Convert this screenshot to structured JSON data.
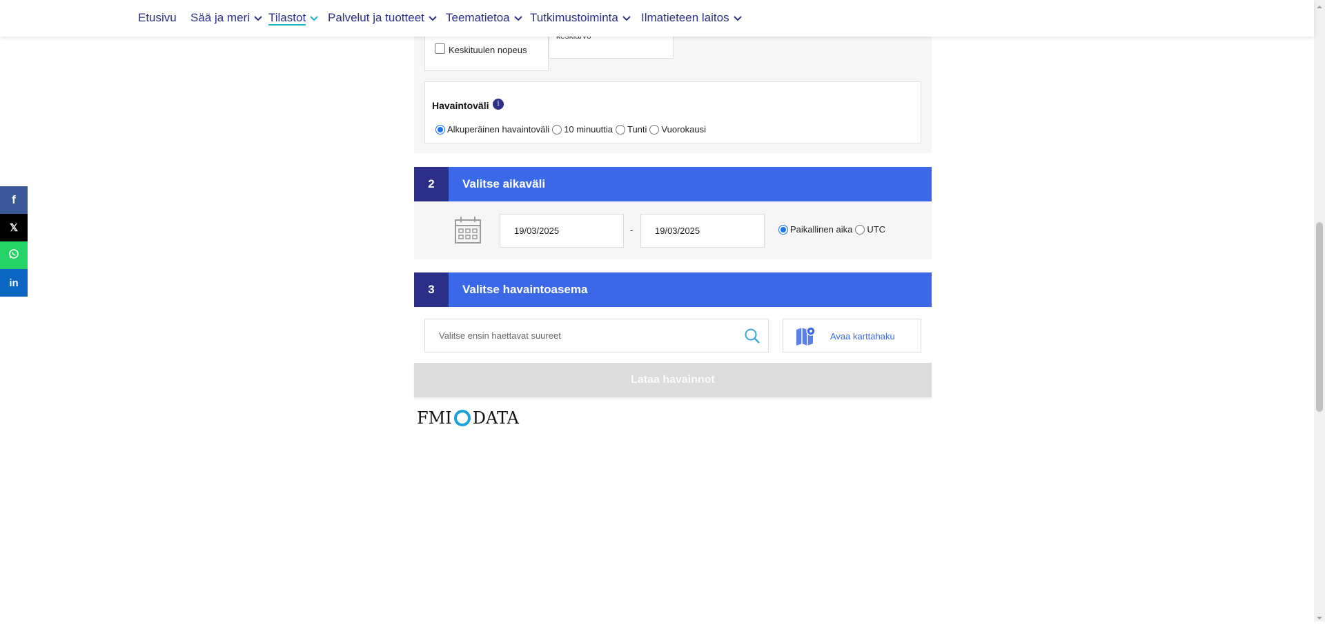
{
  "nav": {
    "items": [
      {
        "label": "Etusivu",
        "has_chevron": false,
        "active": false
      },
      {
        "label": "Sää ja meri",
        "has_chevron": true,
        "active": false
      },
      {
        "label": "Tilastot",
        "has_chevron": true,
        "active": true
      },
      {
        "label": "Palvelut ja tuotteet",
        "has_chevron": true,
        "active": false
      },
      {
        "label": "Teematietoa",
        "has_chevron": true,
        "active": false
      },
      {
        "label": "Tutkimustoiminta",
        "has_chevron": true,
        "active": false
      },
      {
        "label": "Ilmatieteen laitos",
        "has_chevron": true,
        "active": false
      }
    ]
  },
  "share": {
    "facebook": "f",
    "x": "𝕏",
    "whatsapp": "whatsapp-icon",
    "linkedin": "in"
  },
  "section1": {
    "checkbox_label": "Keskituulen nopeus",
    "partial_label": "keskiarvo",
    "interval": {
      "title": "Havaintoväli",
      "info": "i",
      "options": [
        {
          "label": "Alkuperäinen havaintoväli",
          "selected": true
        },
        {
          "label": "10 minuuttia",
          "selected": false
        },
        {
          "label": "Tunti",
          "selected": false
        },
        {
          "label": "Vuorokausi",
          "selected": false
        }
      ]
    }
  },
  "section2": {
    "number": "2",
    "title": "Valitse aikaväli",
    "start_date": "19/03/2025",
    "separator": "-",
    "end_date": "19/03/2025",
    "timezone": [
      {
        "label": "Paikallinen aika",
        "selected": true
      },
      {
        "label": "UTC",
        "selected": false
      }
    ]
  },
  "section3": {
    "number": "3",
    "title": "Valitse havaintoasema",
    "search_placeholder": "Valitse ensin haettavat suureet",
    "map_button": "Avaa karttahaku"
  },
  "download_button": "Lataa havainnot",
  "logo": {
    "left": "FMI",
    "right": "DATA"
  },
  "colors": {
    "nav_text": "#2c2f87",
    "active_underline": "#1ab3c3",
    "section_header": "#3b68e6",
    "section_number": "#2c2f87",
    "disabled_button": "#dcdcdc"
  }
}
